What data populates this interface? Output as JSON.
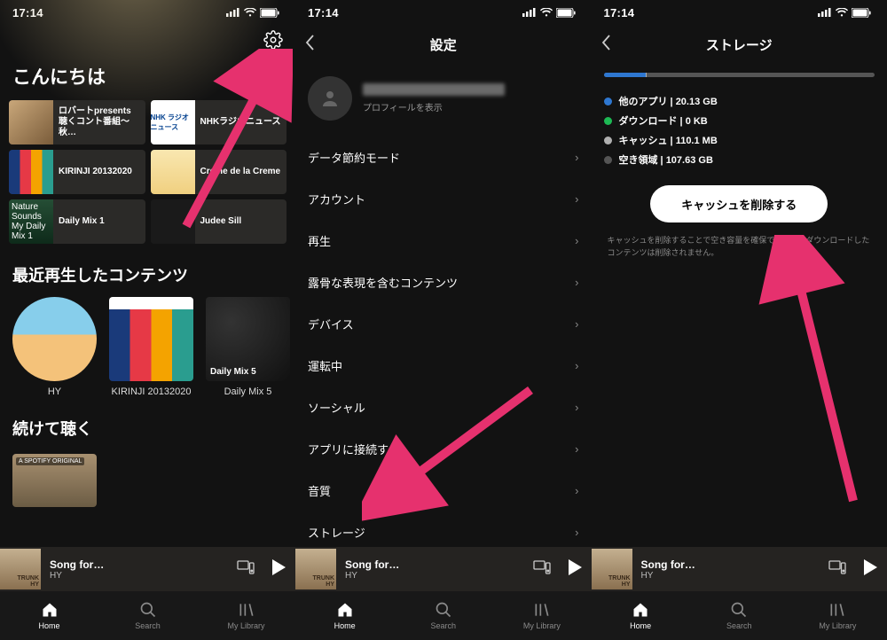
{
  "status": {
    "time": "17:14"
  },
  "screen1": {
    "greeting": "こんにちは",
    "shortcuts": [
      {
        "label": "ロバートpresents聴くコント番組～秋…"
      },
      {
        "label": "NHKラジオニュース",
        "badge": "NHK ラジオニュース"
      },
      {
        "label": "KIRINJI 20132020"
      },
      {
        "label": "Creme de la Creme"
      },
      {
        "label": "Daily Mix 1",
        "sub": "Nature Sounds",
        "sub2": "My Daily Mix 1"
      },
      {
        "label": "Judee Sill"
      }
    ],
    "recent_title": "最近再生したコンテンツ",
    "recent": [
      {
        "label": "HY"
      },
      {
        "label": "KIRINJI 20132020"
      },
      {
        "label": "Daily Mix 5"
      }
    ],
    "continue_title": "続けて聴く",
    "continue_badge": "A SPOTIFY ORIGINAL"
  },
  "now_playing": {
    "title": "Song for…",
    "artist": "HY",
    "art_top": "TRUNK",
    "art_bot": "HY"
  },
  "tabs": {
    "home": "Home",
    "search": "Search",
    "library": "My Library"
  },
  "screen2": {
    "title": "設定",
    "profile_sub": "プロフィールを表示",
    "items": [
      "データ節約モード",
      "アカウント",
      "再生",
      "露骨な表現を含むコンテンツ",
      "デバイス",
      "運転中",
      "ソーシャル",
      "アプリに接続する",
      "音質",
      "ストレージ"
    ]
  },
  "screen3": {
    "title": "ストレージ",
    "bar": {
      "other_pct": 15.7,
      "download_pct": 0,
      "cache_pct": 0.08
    },
    "legend": [
      {
        "color": "#2e77d0",
        "label": "他のアプリ | 20.13 GB"
      },
      {
        "color": "#1db954",
        "label": "ダウンロード | 0 KB"
      },
      {
        "color": "#b0b0b0",
        "label": "キャッシュ | 110.1 MB"
      },
      {
        "color": "#555555",
        "label": "空き領域 | 107.63 GB"
      }
    ],
    "clear_label": "キャッシュを削除する",
    "note": "キャッシュを削除することで空き容量を確保できます。ダウンロードしたコンテンツは削除されません。"
  }
}
